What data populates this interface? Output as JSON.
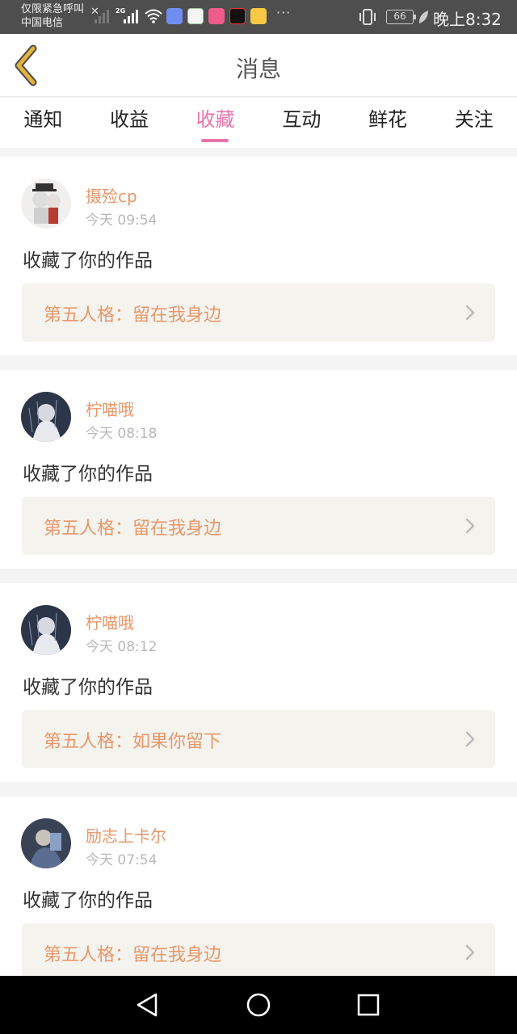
{
  "status_bar": {
    "line1": "仅限紧急呼叫",
    "carrier": "中国电信",
    "network": "2G",
    "battery": "66",
    "time": "晚上8:32",
    "more": "···"
  },
  "header": {
    "title": "消息"
  },
  "tabs": [
    {
      "label": "通知",
      "active": false
    },
    {
      "label": "收益",
      "active": false
    },
    {
      "label": "收藏",
      "active": true
    },
    {
      "label": "互动",
      "active": false
    },
    {
      "label": "鲜花",
      "active": false
    },
    {
      "label": "关注",
      "active": false
    }
  ],
  "notifications": [
    {
      "user": "摄殓cp",
      "time": "今天 09:54",
      "action": "收藏了你的作品",
      "work": "第五人格：留在我身边"
    },
    {
      "user": "柠喵哦",
      "time": "今天 08:18",
      "action": "收藏了你的作品",
      "work": "第五人格：留在我身边"
    },
    {
      "user": "柠喵哦",
      "time": "今天 08:12",
      "action": "收藏了你的作品",
      "work": "第五人格：如果你留下"
    },
    {
      "user": "励志上卡尔",
      "time": "今天 07:54",
      "action": "收藏了你的作品",
      "work": "第五人格：留在我身边"
    }
  ],
  "colors": {
    "accent_pink": "#e873aa",
    "name_orange": "#e8976a",
    "back_arrow": "#e2b23a"
  },
  "icons": {
    "back": "back-arrow-icon",
    "chevron": "chevron-right-icon",
    "nav_back": "triangle-back-icon",
    "nav_home": "circle-home-icon",
    "nav_recent": "square-recent-icon"
  }
}
